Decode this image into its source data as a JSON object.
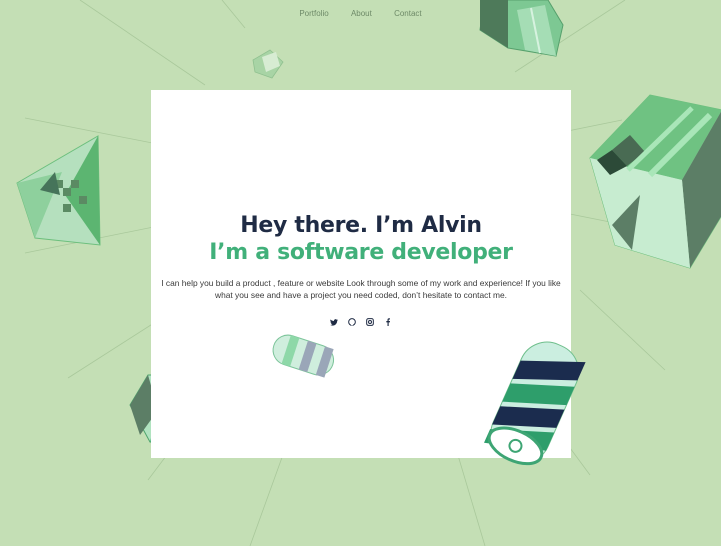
{
  "nav": {
    "items": [
      {
        "label": "Portfolio"
      },
      {
        "label": "About"
      },
      {
        "label": "Contact"
      }
    ]
  },
  "hero": {
    "title": "Hey there. I’m Alvin",
    "subtitle": "I’m a software developer",
    "description": "I can help you build a product , feature or website Look through some of my work and experience! If you like what you see and have a project you need coded, don’t hesitate to contact me."
  },
  "socials": [
    {
      "icon": "twitter-icon",
      "glyph": "🐦"
    },
    {
      "icon": "github-icon",
      "glyph": "◔"
    },
    {
      "icon": "instagram-icon",
      "glyph": "▣"
    },
    {
      "icon": "facebook-icon",
      "glyph": "f"
    }
  ],
  "colors": {
    "background": "#c4dfb5",
    "title": "#1f2b44",
    "accent": "#41b07a"
  }
}
